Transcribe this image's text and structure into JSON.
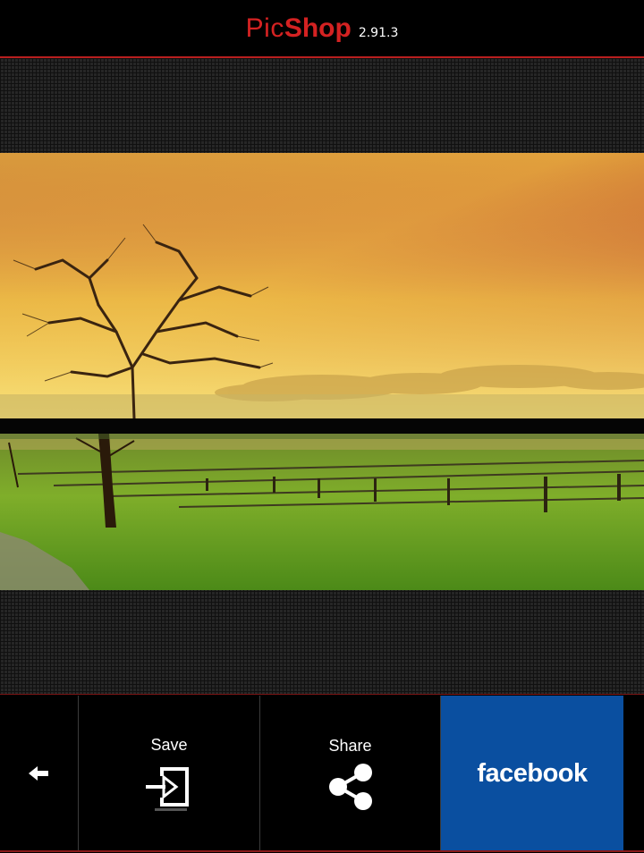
{
  "header": {
    "title_part1": "Pic",
    "title_part2": "Shop",
    "version": "2.91.3"
  },
  "toolbar": {
    "back_icon": "arrow-left-icon",
    "save_label": "Save",
    "save_icon": "sign-in-save-icon",
    "share_label": "Share",
    "share_icon": "share-icon",
    "facebook_label": "facebook"
  },
  "colors": {
    "accent": "#d42222",
    "facebook": "#0a4fa0"
  }
}
